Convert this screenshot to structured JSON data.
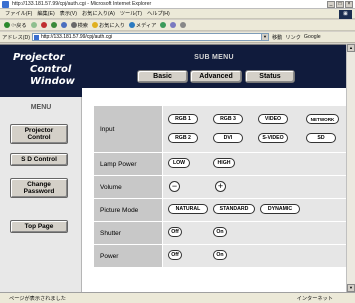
{
  "browser": {
    "title": "http://133.181.57.99/cpj/auth.cgi - Microsoft Internet Explorer",
    "window_buttons": [
      "_",
      "□",
      "×"
    ],
    "menu": [
      "ファイル(F)",
      "編集(E)",
      "表示(V)",
      "お気に入り(A)",
      "ツール(T)",
      "ヘルプ(H)"
    ],
    "toolbar": [
      "⇦戻る",
      "→",
      "検索",
      "お気に入り",
      "メディア"
    ],
    "address_label": "アドレス(D)",
    "address_value": "http://133.181.57.99/cpj/auth.cgi",
    "go_label": "移動",
    "links_label": "リンク",
    "google_label": "Google",
    "status_text": "ページが表示されました",
    "zone_text": "インターネット"
  },
  "nav": {
    "logo": [
      "Projector",
      "Control",
      "Window"
    ],
    "menu_title": "MENU",
    "items": [
      {
        "label": "Projector Control",
        "lines": [
          "Projector",
          "Control"
        ]
      },
      {
        "label": "SD Control",
        "lines": [
          "S D Control"
        ]
      },
      {
        "label": "Change Password",
        "lines": [
          "Change",
          "Password"
        ]
      },
      {
        "label": "Top Page",
        "lines": [
          "Top Page"
        ]
      }
    ]
  },
  "submenu": {
    "title": "SUB MENU",
    "tabs": [
      "Basic",
      "Advanced",
      "Status"
    ]
  },
  "controls": {
    "input": {
      "label": "Input",
      "options": [
        "RGB 1",
        "RGB 3",
        "VIDEO",
        "NETWORK",
        "RGB 2",
        "DVI",
        "S-VIDEO",
        "SD"
      ]
    },
    "lamp_power": {
      "label": "Lamp Power",
      "options": [
        "LOW",
        "HIGH"
      ]
    },
    "volume": {
      "label": "Volume",
      "options": [
        "−",
        "+"
      ]
    },
    "picture_mode": {
      "label": "Picture Mode",
      "options": [
        "NATURAL",
        "STANDARD",
        "DYNAMIC"
      ]
    },
    "shutter": {
      "label": "Shutter",
      "options": [
        "Off",
        "On"
      ]
    },
    "power": {
      "label": "Power",
      "options": [
        "Off",
        "On"
      ]
    }
  }
}
